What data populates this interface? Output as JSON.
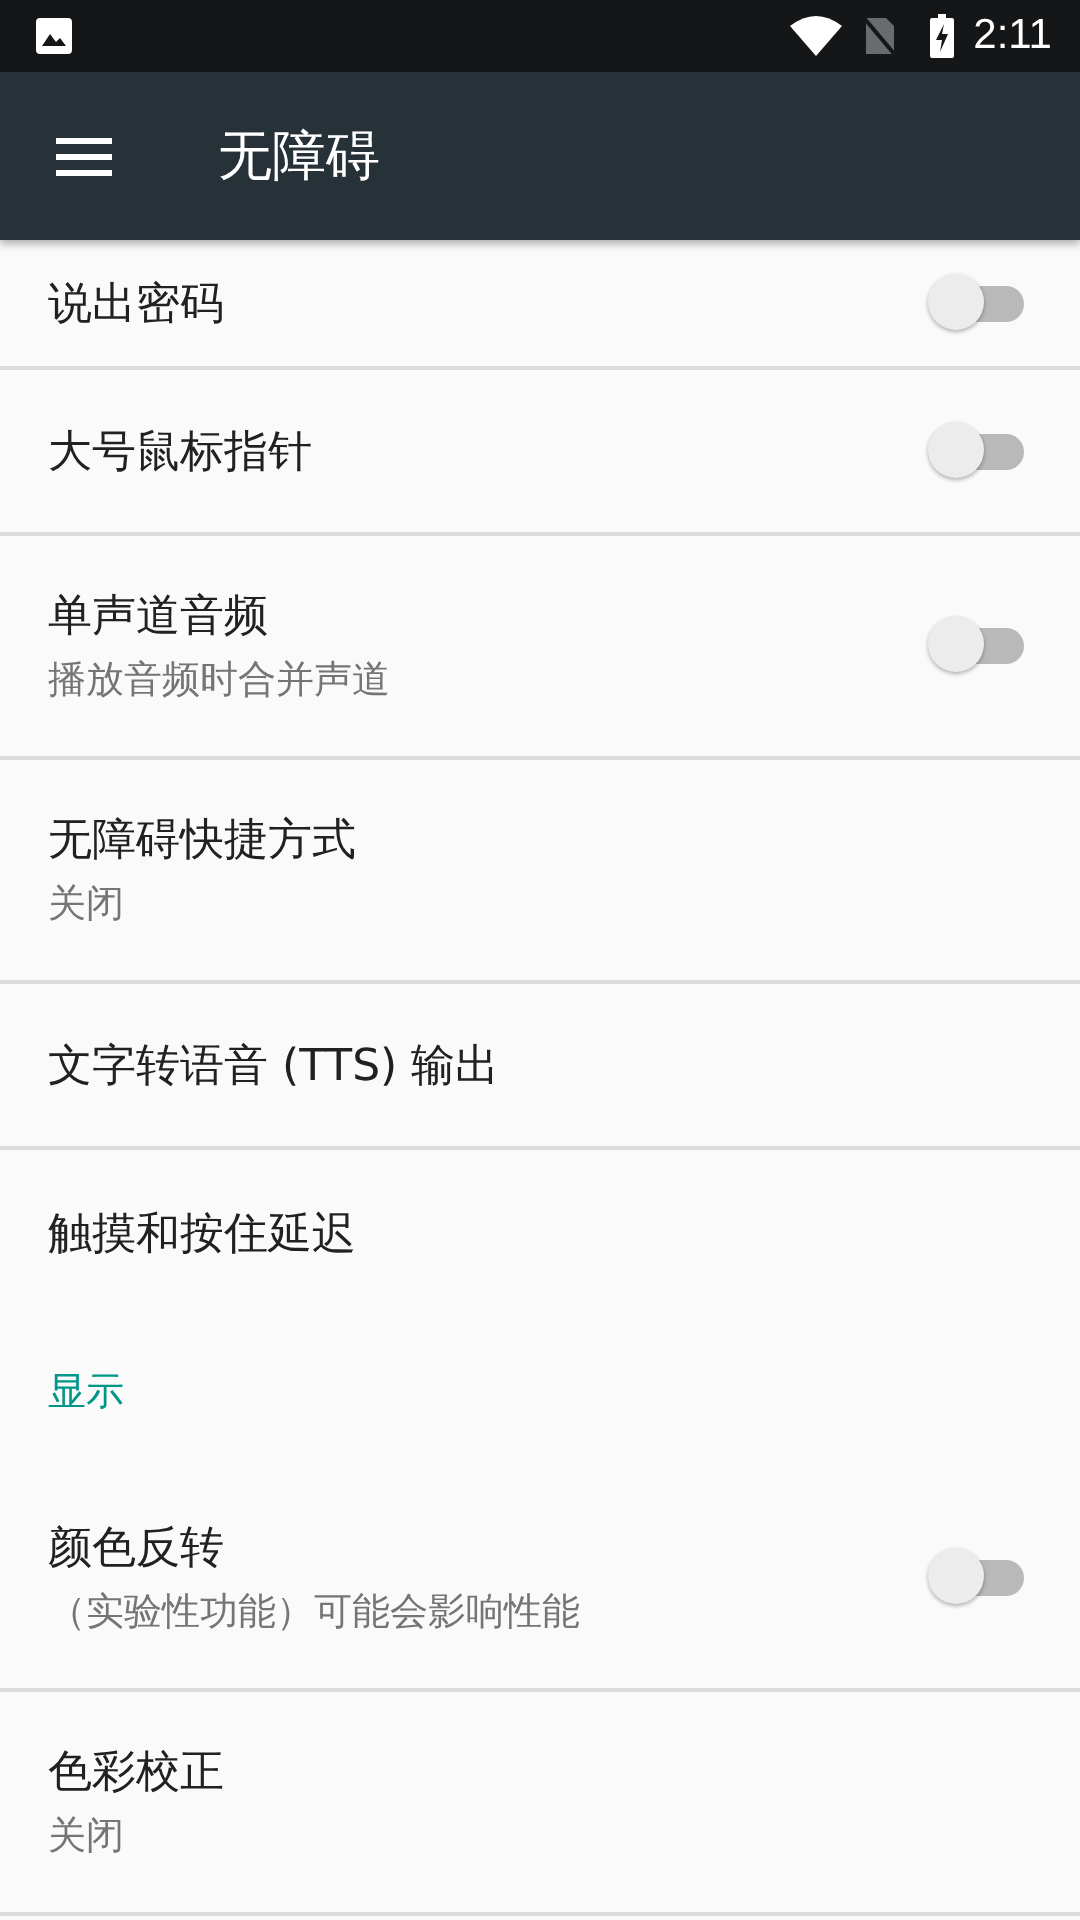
{
  "status_bar": {
    "time": "2:11"
  },
  "app_bar": {
    "title": "无障碍"
  },
  "items": [
    {
      "kind": "toggle",
      "title": "说出密码",
      "on": false
    },
    {
      "kind": "toggle",
      "title": "大号鼠标指针",
      "on": false
    },
    {
      "kind": "toggle",
      "title": "单声道音频",
      "summary": "播放音频时合并声道",
      "on": false
    },
    {
      "kind": "item",
      "title": "无障碍快捷方式",
      "summary": "关闭"
    },
    {
      "kind": "item",
      "title": "文字转语音 (TTS) 输出"
    },
    {
      "kind": "item",
      "title": "触摸和按住延迟"
    },
    {
      "kind": "header",
      "title": "显示"
    },
    {
      "kind": "toggle",
      "title": "颜色反转",
      "summary": "（实验性功能）可能会影响性能",
      "on": false
    },
    {
      "kind": "item",
      "title": "色彩校正",
      "summary": "关闭"
    }
  ]
}
